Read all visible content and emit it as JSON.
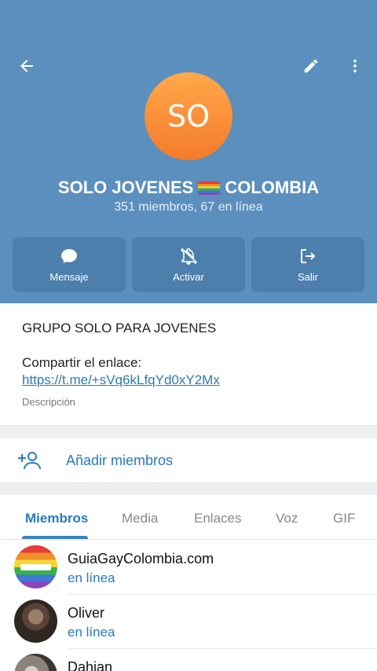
{
  "group": {
    "avatar_initials": "SO",
    "title_part1": "SOLO JOVENES",
    "title_part2": "COLOMBIA",
    "subtitle": "351 miembros, 67 en línea"
  },
  "actions": [
    {
      "label": "Mensaje",
      "icon": "chat-bubble-icon"
    },
    {
      "label": "Activar",
      "icon": "bell-off-icon"
    },
    {
      "label": "Salir",
      "icon": "logout-icon"
    }
  ],
  "info": {
    "description": "GRUPO SOLO PARA JOVENES",
    "share_text": "Compartir el enlace:",
    "link": "https://t.me/+sVq6kLfqYd0xY2Mx",
    "caption": "Descripción"
  },
  "add_members": {
    "label": "Añadir miembros"
  },
  "tabs": [
    {
      "label": "Miembros",
      "active": true
    },
    {
      "label": "Media"
    },
    {
      "label": "Enlaces"
    },
    {
      "label": "Voz"
    },
    {
      "label": "GIF"
    }
  ],
  "members": [
    {
      "name": "GuiaGayColombia.com",
      "status": "en línea"
    },
    {
      "name": "Oliver",
      "status": "en línea"
    },
    {
      "name": "Dahian",
      "status": ""
    }
  ],
  "colors": {
    "header": "#5b8fbe",
    "accent": "#2a7ab8",
    "avatar": "#f8922f"
  }
}
